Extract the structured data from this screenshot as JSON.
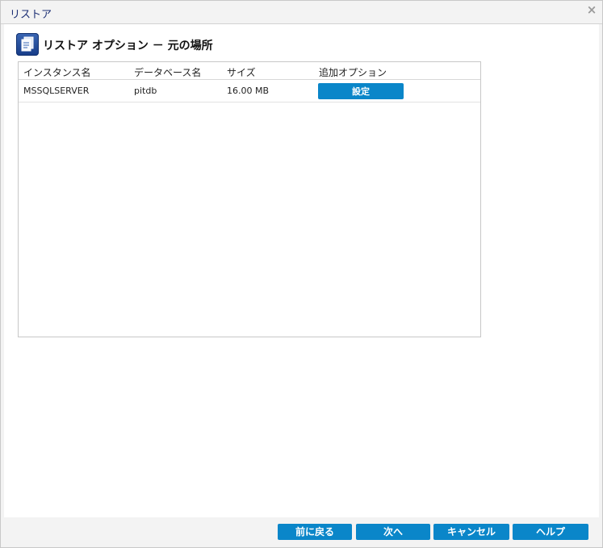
{
  "window": {
    "title": "リストア",
    "close_symbol": "×"
  },
  "section": {
    "title": "リストア オプション － 元の場所",
    "icon": "document-stack-icon"
  },
  "table": {
    "columns": [
      "インスタンス名",
      "データベース名",
      "サイズ",
      "追加オプション"
    ],
    "rows": [
      {
        "instance": "MSSQLSERVER",
        "database": "pitdb",
        "size": "16.00 MB",
        "action_label": "設定"
      }
    ]
  },
  "footer": {
    "back_label": "前に戻る",
    "next_label": "次へ",
    "cancel_label": "キャンセル",
    "help_label": "ヘルプ"
  },
  "colors": {
    "accent": "#0a86c9",
    "title_text": "#1c2f74"
  }
}
